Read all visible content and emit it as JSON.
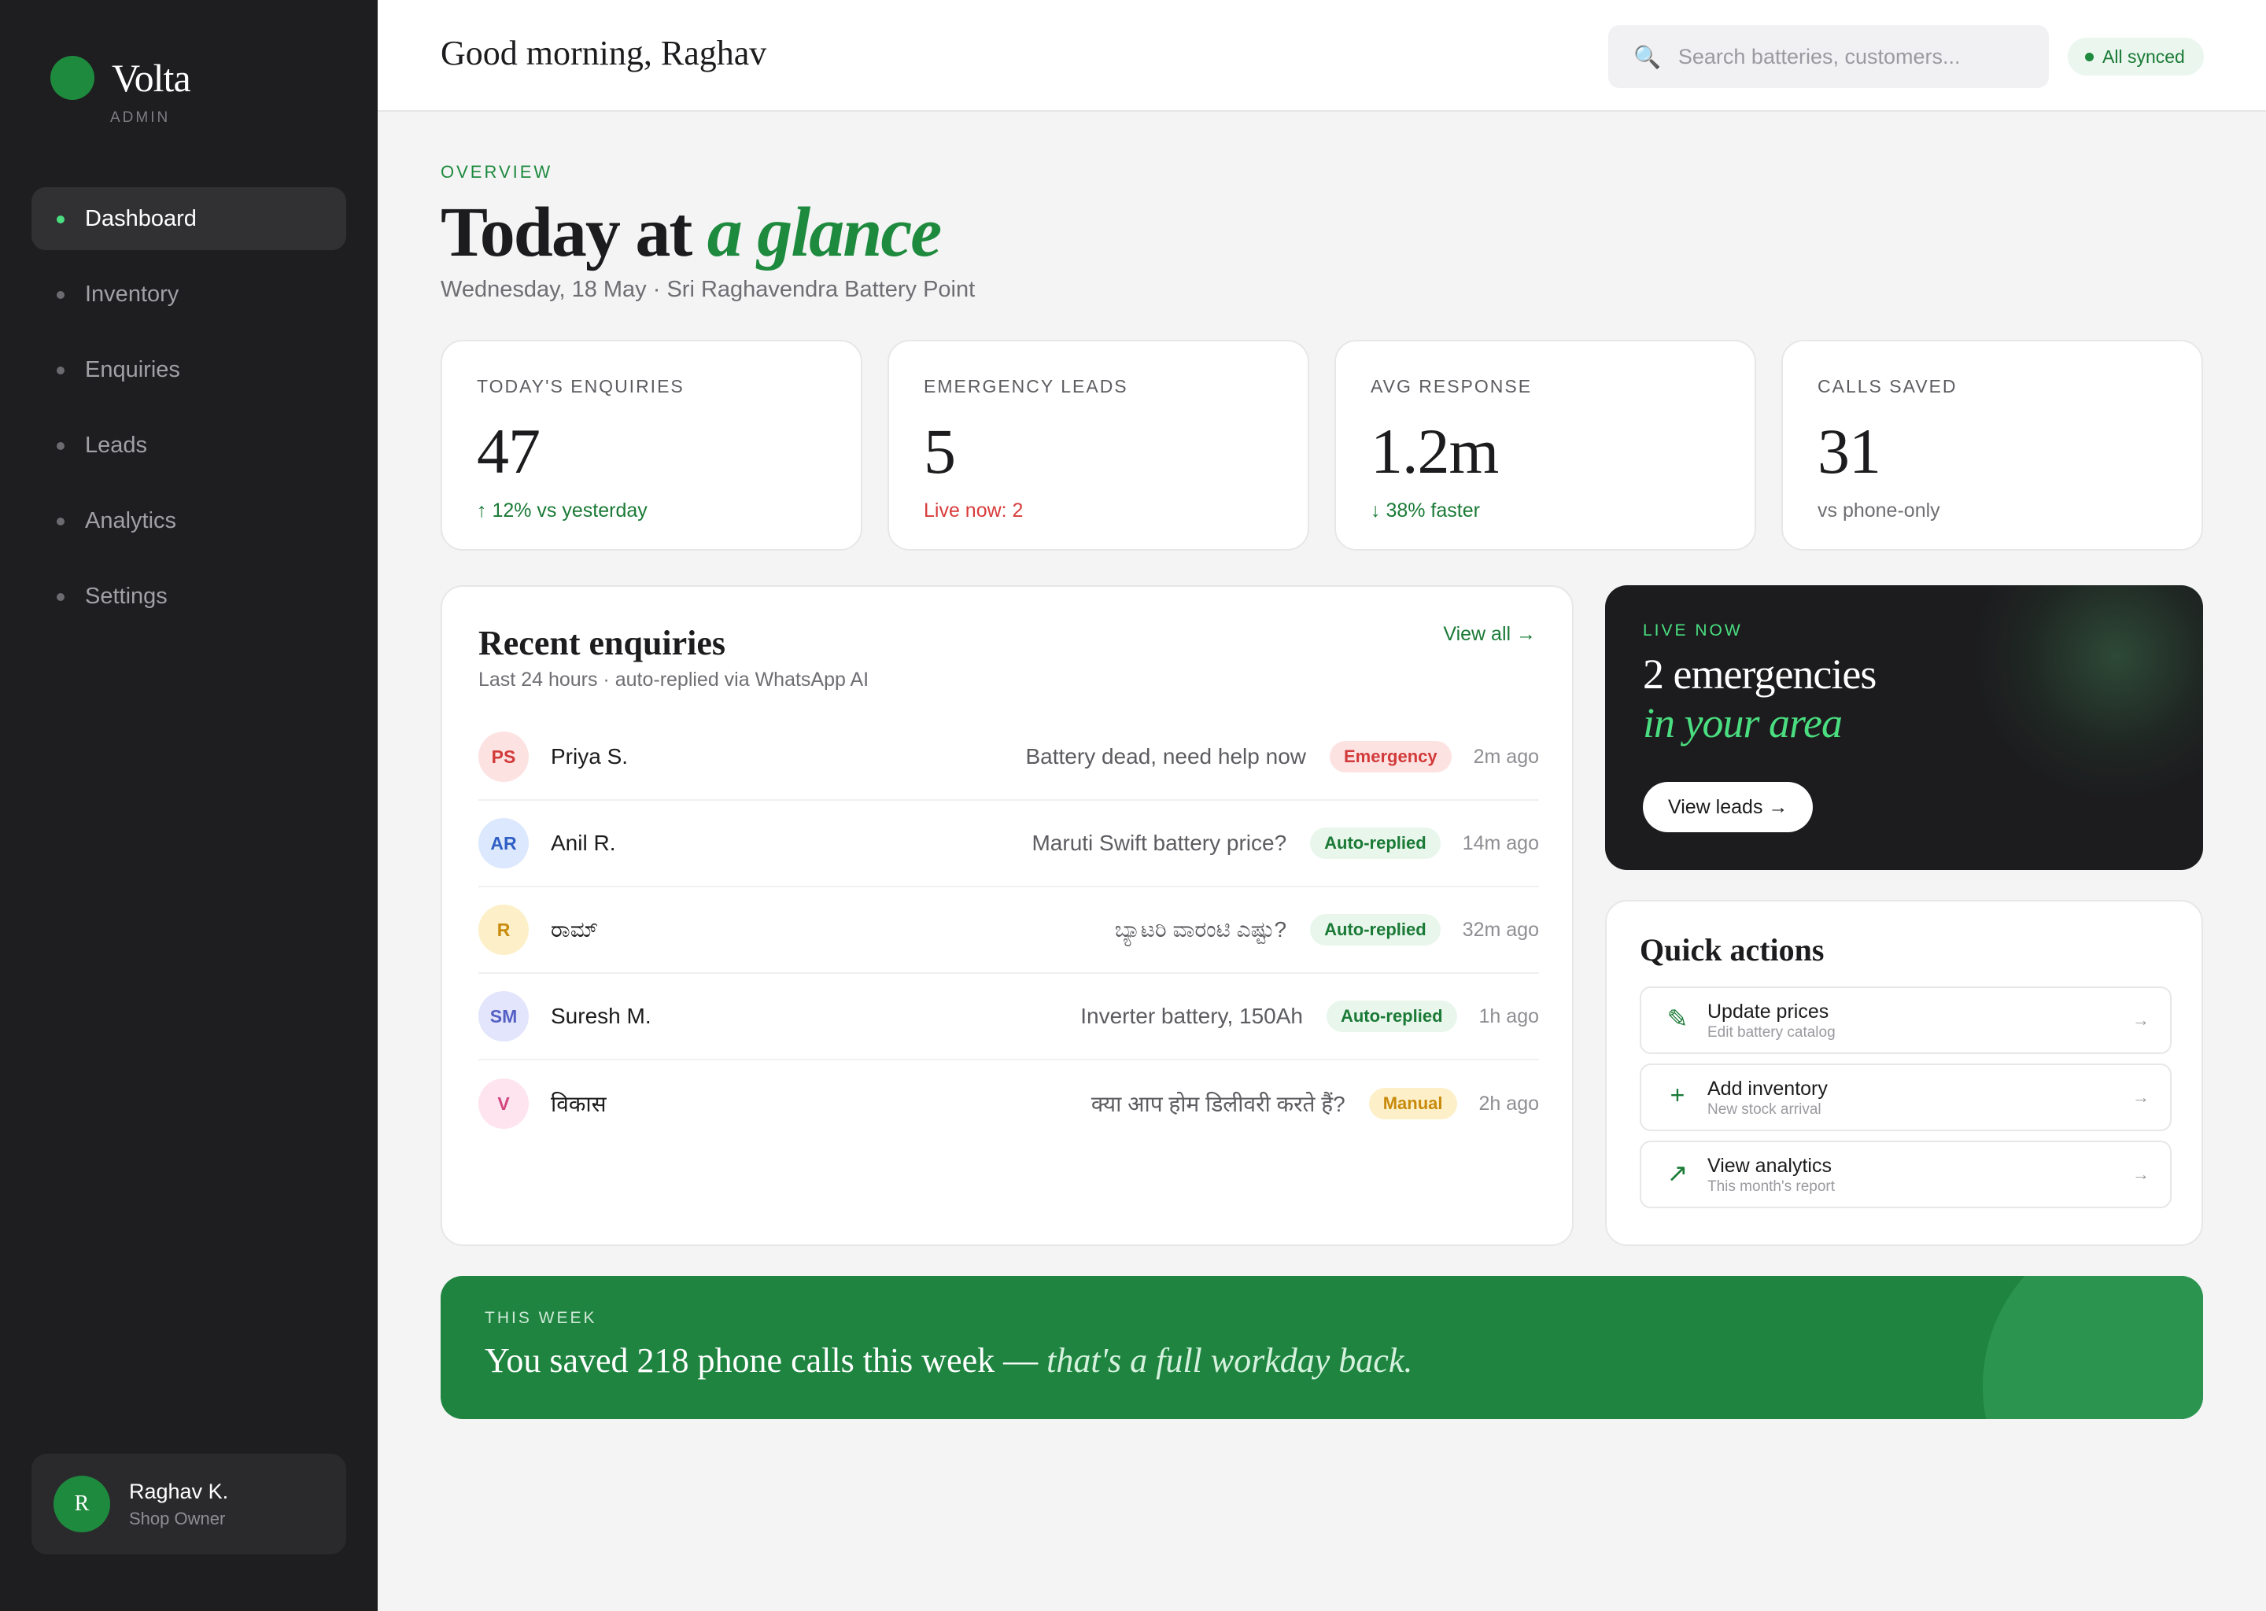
{
  "brand": {
    "name": "Volta",
    "subtitle": "ADMIN"
  },
  "sidebar": {
    "items": [
      {
        "label": "Dashboard",
        "active": true
      },
      {
        "label": "Inventory",
        "active": false
      },
      {
        "label": "Enquiries",
        "active": false
      },
      {
        "label": "Leads",
        "active": false
      },
      {
        "label": "Analytics",
        "active": false
      },
      {
        "label": "Settings",
        "active": false
      }
    ],
    "user": {
      "initial": "R",
      "name": "Raghav K.",
      "role": "Shop Owner"
    }
  },
  "header": {
    "greeting": "Good morning, Raghav",
    "search_placeholder": "Search batteries, customers...",
    "search_icon": "search-icon",
    "sync_status": "All synced"
  },
  "overview": {
    "eyebrow": "OVERVIEW",
    "title_plain": "Today at ",
    "title_accent": "a glance",
    "date_line": "Wednesday, 18 May · Sri Raghavendra Battery Point"
  },
  "stats": [
    {
      "label": "TODAY'S ENQUIRIES",
      "value": "47",
      "sub": "↑ 12% vs yesterday",
      "tone": "green"
    },
    {
      "label": "EMERGENCY LEADS",
      "value": "5",
      "sub": "Live now: 2",
      "tone": "red"
    },
    {
      "label": "AVG RESPONSE",
      "value": "1.2m",
      "sub": "↓ 38% faster",
      "tone": "green"
    },
    {
      "label": "CALLS SAVED",
      "value": "31",
      "sub": "vs phone-only",
      "tone": "grey"
    }
  ],
  "recent": {
    "title": "Recent enquiries",
    "subtitle": "Last 24 hours · auto-replied via WhatsApp AI",
    "view_all": "View all →",
    "rows": [
      {
        "initials": "PS",
        "name": "Priya S.",
        "message": "Battery dead, need help now",
        "status": "Emergency",
        "status_type": "emergency",
        "time": "2m ago",
        "avatar_bg": "#fde2e2",
        "avatar_fg": "#d23a3a"
      },
      {
        "initials": "AR",
        "name": "Anil R.",
        "message": "Maruti Swift battery price?",
        "status": "Auto-replied",
        "status_type": "auto",
        "time": "14m ago",
        "avatar_bg": "#dbe8fd",
        "avatar_fg": "#2f5fc4"
      },
      {
        "initials": "R",
        "name": "ರಾಮ್",
        "message": "ಬ್ಯಾಟರಿ ವಾರಂಟಿ ಎಷ್ಟು?",
        "status": "Auto-replied",
        "status_type": "auto",
        "time": "32m ago",
        "avatar_bg": "#fdf0c8",
        "avatar_fg": "#c98a0c"
      },
      {
        "initials": "SM",
        "name": "Suresh M.",
        "message": "Inverter battery, 150Ah",
        "status": "Auto-replied",
        "status_type": "auto",
        "time": "1h ago",
        "avatar_bg": "#e2e5fb",
        "avatar_fg": "#5560c4"
      },
      {
        "initials": "V",
        "name": "विकास",
        "message": "क्या आप होम डिलीवरी करते हैं?",
        "status": "Manual",
        "status_type": "manual",
        "time": "2h ago",
        "avatar_bg": "#fde4ef",
        "avatar_fg": "#d2457e"
      }
    ]
  },
  "live": {
    "eyebrow": "LIVE NOW",
    "title_line1": "2 emergencies",
    "title_line2": "in your area",
    "button": "View leads →"
  },
  "quick_actions": {
    "title": "Quick actions",
    "items": [
      {
        "icon": "pencil-icon",
        "glyph": "✎",
        "title": "Update prices",
        "subtitle": "Edit battery catalog",
        "arrow": "→"
      },
      {
        "icon": "plus-icon",
        "glyph": "+",
        "title": "Add inventory",
        "subtitle": "New stock arrival",
        "arrow": "→"
      },
      {
        "icon": "trend-arrow-icon",
        "glyph": "↗",
        "title": "View analytics",
        "subtitle": "This month's report",
        "arrow": "→"
      }
    ]
  },
  "week": {
    "eyebrow": "THIS WEEK",
    "text_plain": "You saved 218 phone calls this week — ",
    "text_accent": "that's a full workday back."
  },
  "colors": {
    "brand_green": "#1e8a3e",
    "accent_mint": "#4ade80",
    "sidebar_bg": "#1e1e20",
    "emergency_red": "#d93b3b"
  }
}
